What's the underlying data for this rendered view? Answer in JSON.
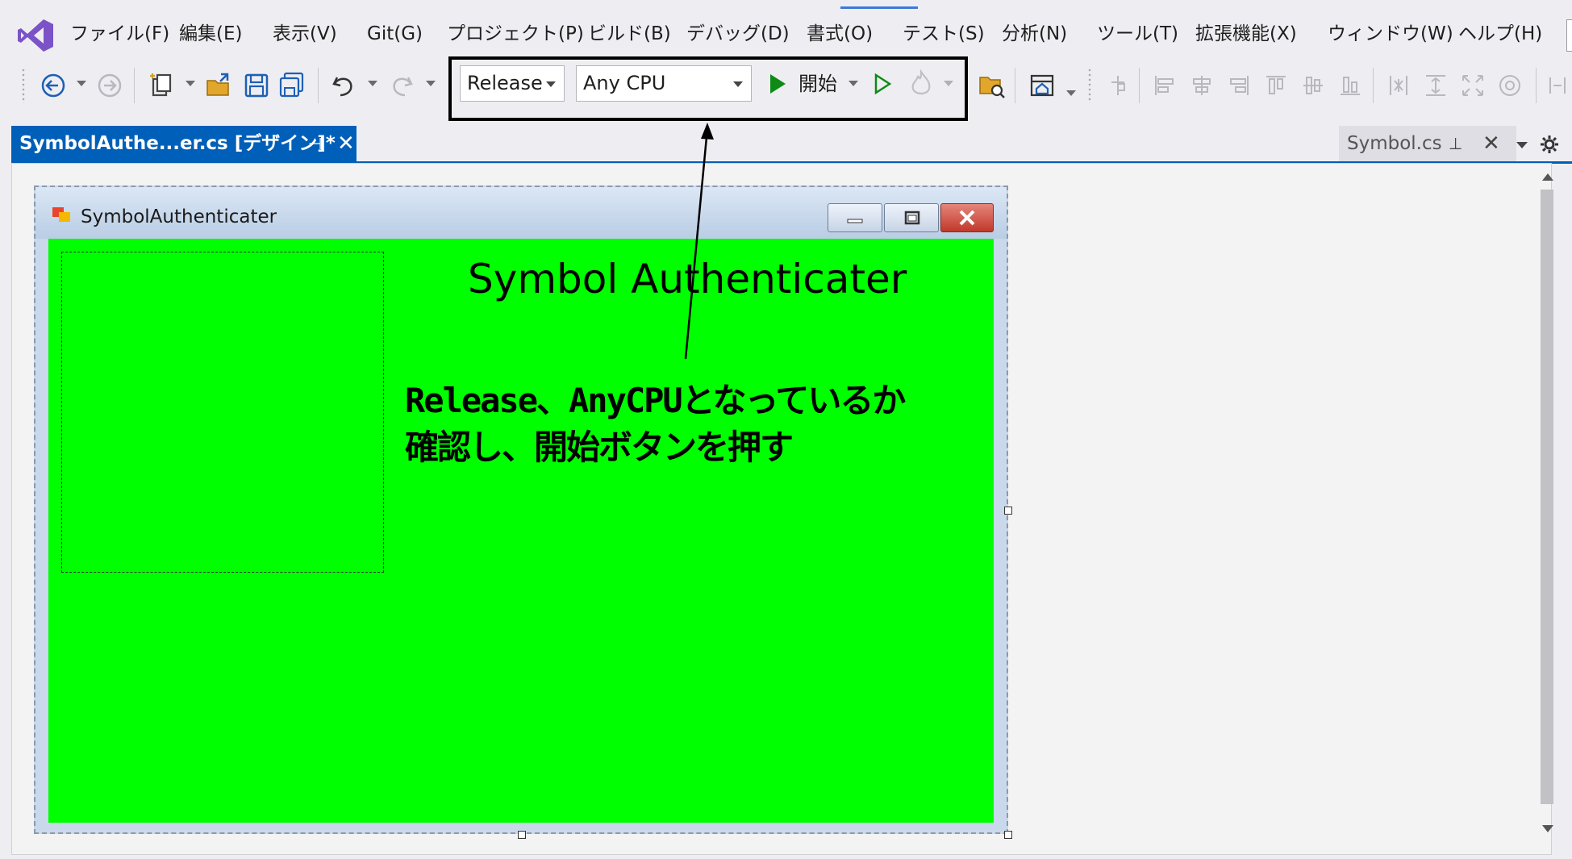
{
  "menubar": {
    "items": [
      {
        "label": "ファイル(F)"
      },
      {
        "label": "編集(E)"
      },
      {
        "label": "表示(V)"
      },
      {
        "label": "Git(G)"
      },
      {
        "label": "プロジェクト(P)"
      },
      {
        "label": "ビルド(B)"
      },
      {
        "label": "デバッグ(D)"
      },
      {
        "label": "書式(O)"
      },
      {
        "label": "テスト(S)"
      },
      {
        "label": "分析(N)"
      },
      {
        "label": "ツール(T)"
      },
      {
        "label": "拡張機能(X)"
      },
      {
        "label": "ウィンドウ(W)"
      },
      {
        "label": "ヘルプ(H)"
      }
    ]
  },
  "toolbar": {
    "configuration": "Release",
    "platform": "Any CPU",
    "start_label": "開始",
    "accent_color": "#0e8a16"
  },
  "tabs": {
    "active": {
      "label": "SymbolAuthe...er.cs [デザイン]*",
      "pin_glyph": "⊣",
      "close_glyph": "✕"
    },
    "inactive": {
      "label": "Symbol.cs",
      "pin_glyph": "⊥",
      "close_glyph": "✕"
    },
    "accent_color": "#005fb8"
  },
  "form": {
    "window_title": "SymbolAuthenticater",
    "heading": "Symbol Authenticater",
    "background_color": "#00ff00"
  },
  "annotation": {
    "line1": "Release、AnyCPUとなっているか",
    "line2": "確認し、開始ボタンを押す"
  }
}
